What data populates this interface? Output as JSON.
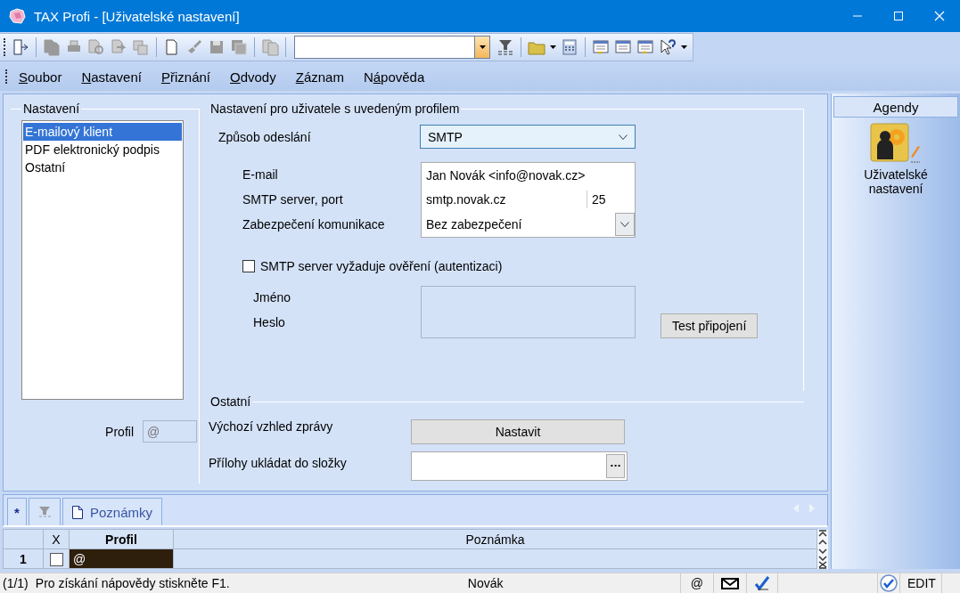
{
  "window": {
    "title": "TAX Profi - [Uživatelské nastavení]"
  },
  "menu": [
    {
      "key": "S",
      "after": "oubor"
    },
    {
      "key": "N",
      "after": "astavení"
    },
    {
      "key": "P",
      "after": "řiznání"
    },
    {
      "key": "O",
      "after": "dvody"
    },
    {
      "key": "Z",
      "after": "áznam"
    },
    {
      "before": "N",
      "key": "á",
      "after": "pověda"
    }
  ],
  "settings_list": {
    "title": "Nastavení",
    "items": [
      {
        "label": "E-mailový klient",
        "selected": true
      },
      {
        "label": "PDF elektronický podpis",
        "selected": false
      },
      {
        "label": "Ostatní",
        "selected": false
      }
    ],
    "profile_label": "Profil",
    "profile_value": "@"
  },
  "profile_section": {
    "title": "Nastavení pro uživatele s uvedeným profilem",
    "send_method_label": "Způsob odeslání",
    "send_method_value": "SMTP",
    "email_label": "E-mail",
    "email_value": "Jan Novák <info@novak.cz>",
    "server_label": "SMTP server, port",
    "server_value": "smtp.novak.cz",
    "port_value": "25",
    "security_label": "Zabezpečení komunikace",
    "security_value": "Bez zabezpečení",
    "auth": {
      "label": "SMTP server vyžaduje ověření (autentizaci)",
      "checked": false
    },
    "name_label": "Jméno",
    "password_label": "Heslo",
    "test_button": "Test připojení"
  },
  "other_section": {
    "title": "Ostatní",
    "appearance_label": "Výchozí vzhled zprávy",
    "appearance_button": "Nastavit",
    "attachments_label": "Přílohy ukládat do složky",
    "browse_button": "···"
  },
  "agenda": {
    "title": "Agendy",
    "items": [
      {
        "label": "Uživatelské nastavení"
      }
    ]
  },
  "bottom_tabs": [
    {
      "kind": "new",
      "label": "*"
    },
    {
      "kind": "filter"
    },
    {
      "kind": "notes",
      "label": "Poznámky"
    }
  ],
  "grid": {
    "columns": [
      "X",
      "Profil",
      "Poznámka"
    ],
    "rows": [
      {
        "number": "1",
        "checked": false,
        "profile": "@",
        "selected": true
      }
    ]
  },
  "status_bar": {
    "record": "(1/1)",
    "hint": "Pro získání nápovědy stiskněte F1.",
    "user": "Novák",
    "profile": "@",
    "mode": "EDIT"
  }
}
